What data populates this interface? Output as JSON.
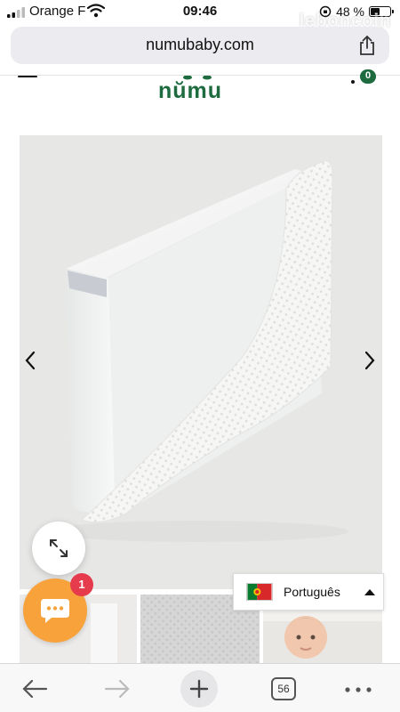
{
  "status_bar": {
    "carrier": "Orange F",
    "time": "09:46",
    "battery": "48 %",
    "battery_level": 0.48
  },
  "watermark": "leboncoin",
  "browser": {
    "url": "numubaby.com"
  },
  "site": {
    "logo": "nŭmu",
    "cart_count": "0"
  },
  "chat": {
    "badge_count": "1"
  },
  "language": {
    "selected": "Português"
  },
  "toolbar": {
    "tab_count": "56"
  },
  "colors": {
    "brand_green": "#1d6b3f",
    "chat_orange": "#f7a23b",
    "badge_red": "#e53b4c"
  },
  "icons": [
    "signal-icon",
    "wifi-icon",
    "battery-icon",
    "share-icon",
    "menu-icon",
    "cart-icon",
    "chevron-left-icon",
    "chevron-right-icon",
    "expand-icon",
    "chat-icon",
    "caret-up-icon",
    "back-arrow-icon",
    "forward-arrow-icon",
    "plus-icon",
    "more-icon"
  ]
}
